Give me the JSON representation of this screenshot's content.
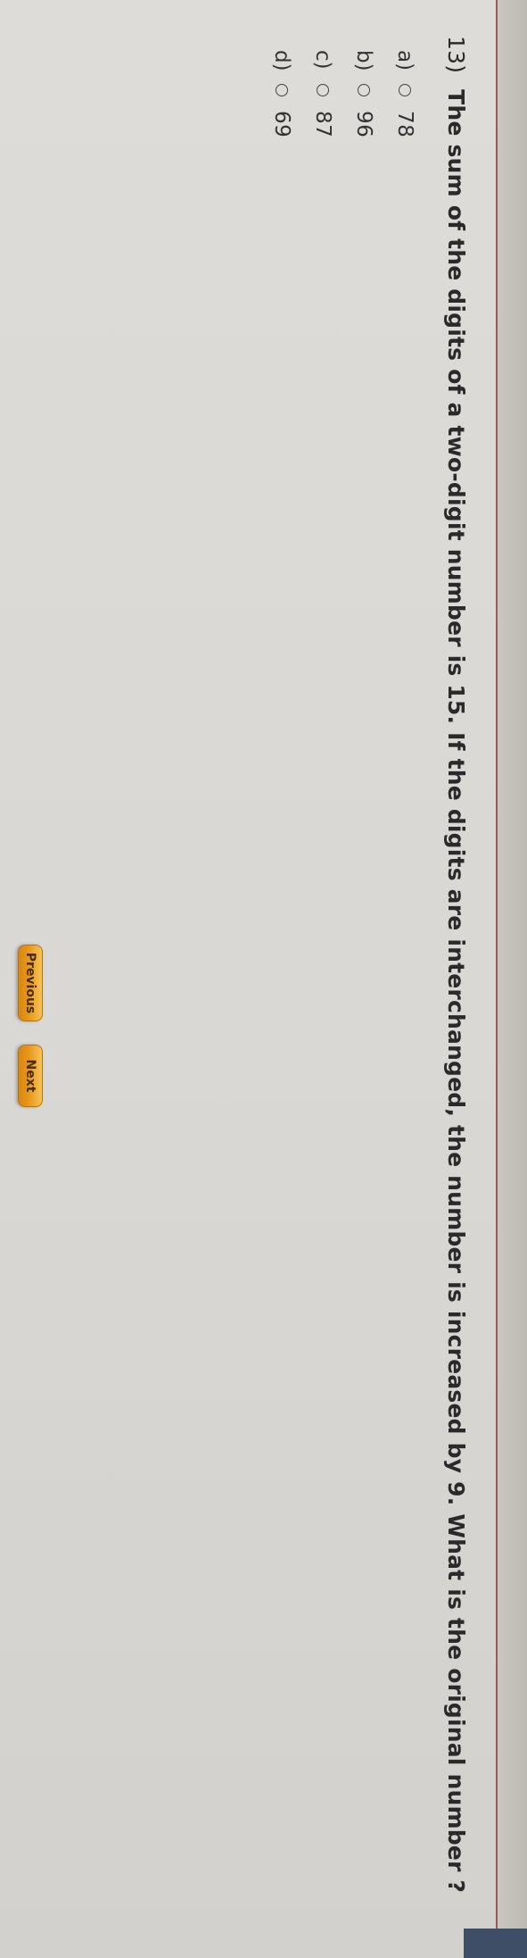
{
  "question": {
    "number": "13)",
    "text": "The sum of the digits of a two-digit number is 15. If the digits are interchanged, the number is increased by 9. What is the original number ?"
  },
  "options": [
    {
      "letter": "a)",
      "value": "78"
    },
    {
      "letter": "b)",
      "value": "96"
    },
    {
      "letter": "c)",
      "value": "87"
    },
    {
      "letter": "d)",
      "value": "69"
    }
  ],
  "navigation": {
    "previous_label": "Previous",
    "next_label": "Next"
  },
  "colors": {
    "button": "#e89a1c",
    "panel_border": "#9b5a4c"
  }
}
